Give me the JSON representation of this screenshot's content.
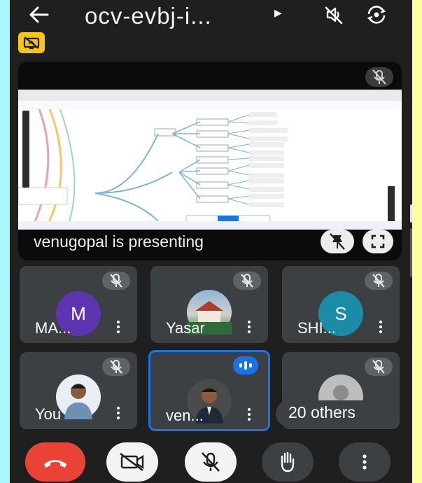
{
  "header": {
    "title": "ocv-evbj-i...",
    "back_icon": "arrow-back-icon",
    "speaker_icon": "speaker-muted-icon",
    "switch_camera_icon": "switch-camera-icon",
    "more_icon": "caret-right-icon"
  },
  "badge": {
    "icon": "screen-share-off-icon",
    "color": "#f5c518"
  },
  "presentation": {
    "label": "venugopal is presenting",
    "mic_icon": "mic-off-icon",
    "pin_icon": "pin-off-icon",
    "fullscreen_icon": "fullscreen-icon"
  },
  "participants": [
    {
      "name": "MA...",
      "initial": "M",
      "avatar_color": "#5e35b1",
      "muted": true
    },
    {
      "name": "Yasar",
      "initial": "",
      "avatar_color": "#6b8fb3",
      "muted": true
    },
    {
      "name": "SHI...",
      "initial": "S",
      "avatar_color": "#1a8ca5",
      "muted": true
    },
    {
      "name": "You",
      "initial": "",
      "avatar_color": "#e7eef6",
      "muted": true
    },
    {
      "name": "ven...",
      "initial": "",
      "avatar_color": "#4b4b4b",
      "muted": false,
      "speaking": true
    },
    {
      "name": "",
      "initial": "",
      "avatar_color": "#bdbdbd",
      "muted": true
    }
  ],
  "others": {
    "label": "20 others"
  },
  "controls": {
    "end_call_icon": "end-call-icon",
    "camera_icon": "camera-off-icon",
    "mic_icon": "mic-off-icon",
    "raise_hand_icon": "raise-hand-icon",
    "more_icon": "more-vert-icon"
  },
  "colors": {
    "end_call": "#ea4335",
    "accent": "#1a73e8",
    "tile": "#3c4043"
  }
}
